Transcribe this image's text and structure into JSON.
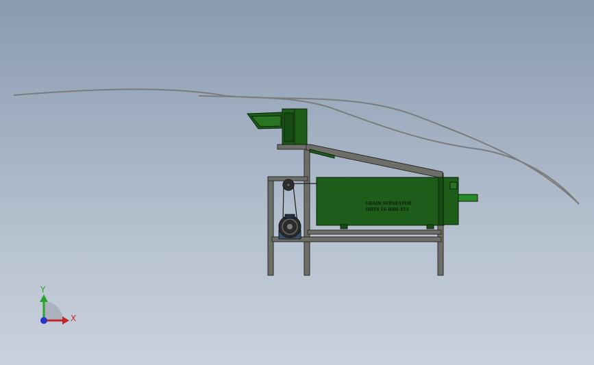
{
  "model": {
    "label_line_1": "GRAIN SEPARATOR",
    "label_line_2": "OHTS 16-BSH-153"
  },
  "triad": {
    "x_label": "X",
    "y_label": "Y",
    "x_color": "#c0262a",
    "y_color": "#2aa22e",
    "z_color": "#2936c8"
  },
  "colors": {
    "machine_green": "#1e5c1a",
    "machine_green_dark": "#133e10",
    "frame": "#6e6e68",
    "outline": "#2a2a28",
    "sketch_curve": "#7c7c7c"
  }
}
